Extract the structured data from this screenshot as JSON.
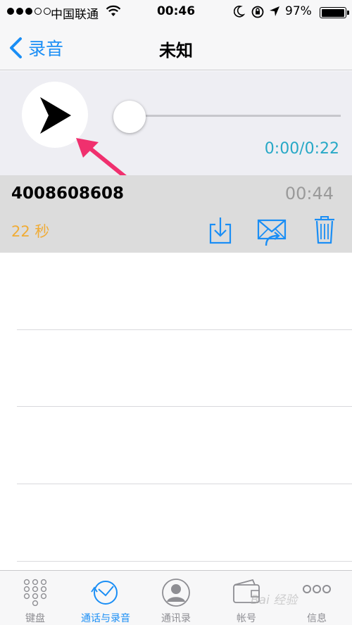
{
  "status_bar": {
    "carrier": "中国联通",
    "time": "00:46",
    "battery": "97%",
    "battery_level": 0.97
  },
  "nav": {
    "back_label": "录音",
    "title": "未知"
  },
  "player": {
    "elapsed": "0:00/0:22",
    "progress": 0,
    "accent_color": "#27a8c6"
  },
  "recording": {
    "number": "4008608608",
    "time": "00:44",
    "duration": "22 秒"
  },
  "tabs": [
    {
      "label": "键盘",
      "icon": "keypad-icon",
      "active": false
    },
    {
      "label": "通话与录音",
      "icon": "recents-clock-icon",
      "active": true
    },
    {
      "label": "通讯录",
      "icon": "contacts-icon",
      "active": false
    },
    {
      "label": "帐号",
      "icon": "wallet-icon",
      "active": false
    },
    {
      "label": "信息",
      "icon": "more-icon",
      "active": false
    }
  ],
  "watermark": "Bai 经验",
  "colors": {
    "ios_blue": "#1a8ef5",
    "duration_orange": "#f0ac36",
    "annotation_pink": "#f0306e"
  }
}
